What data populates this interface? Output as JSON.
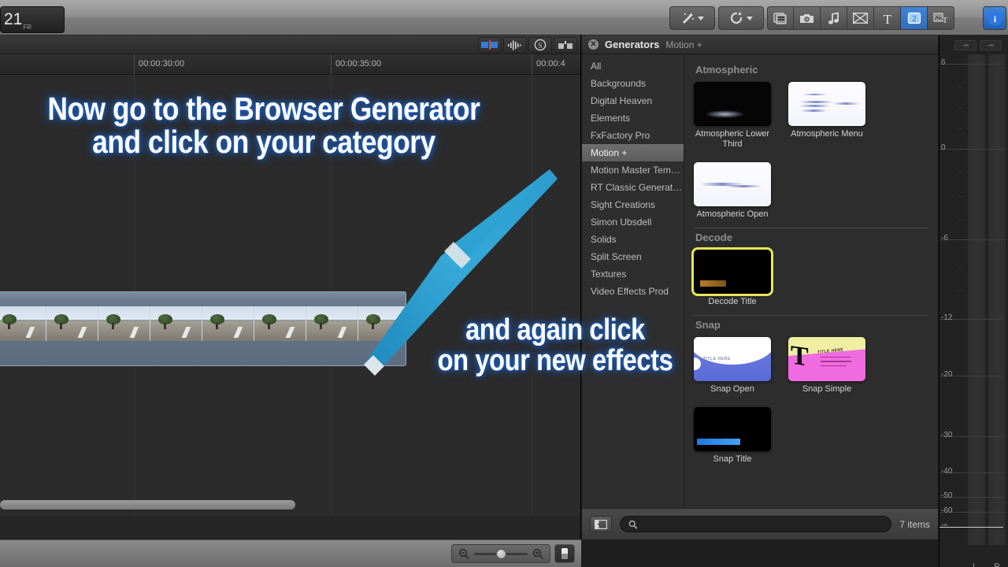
{
  "app": {
    "timecode": "21",
    "timecode_sub": "FR"
  },
  "toolbar": {
    "buttons": [
      {
        "name": "retime-tools",
        "icon": "magic-wand-icon",
        "label": "Enhancements",
        "has_caret": true,
        "active": false
      },
      {
        "name": "speed-tools",
        "icon": "retime-icon",
        "label": "Retime",
        "has_caret": true,
        "active": false
      },
      {
        "name": "media-browser",
        "icon": "media-browser-icon",
        "label": "Media Browser",
        "has_caret": false,
        "active": false
      },
      {
        "name": "photos-browser",
        "icon": "camera-icon",
        "label": "Photos",
        "has_caret": false,
        "active": false
      },
      {
        "name": "music-browser",
        "icon": "music-note-icon",
        "label": "Music and Sound",
        "has_caret": false,
        "active": false
      },
      {
        "name": "titles-browser",
        "icon": "titles-icon",
        "label": "Titles",
        "has_caret": false,
        "active": false
      },
      {
        "name": "text-tool",
        "icon": "text-T-icon",
        "label": "Text",
        "has_caret": false,
        "active": false
      },
      {
        "name": "generators-browser",
        "icon": "generators-icon",
        "label": "Generators",
        "has_caret": false,
        "active": true
      },
      {
        "name": "effects-browser",
        "icon": "effects-text-icon",
        "label": "Effects",
        "has_caret": false,
        "active": false
      }
    ],
    "info_button": {
      "name": "info-button",
      "icon": "info-circle-icon",
      "label": "Inspector"
    }
  },
  "timeline": {
    "tools": [
      "clip-skimming-icon",
      "audio-skimming-icon",
      "solo-icon",
      "snapping-icon"
    ],
    "ruler_ticks": [
      "00:00:30:00",
      "00:00:35:00",
      "00:00:4"
    ],
    "zoom": {
      "zoom_out_icon": "magnifier-minus-icon",
      "zoom_in_icon": "magnifier-plus-icon",
      "appearance_icon": "clip-appearance-icon",
      "value": 40
    },
    "clip": {
      "name": "timeline-filmstrip-clip",
      "frame_count": 9
    }
  },
  "browser": {
    "title": "Generators",
    "subtitle": "Motion +",
    "close_icon": "close-x-icon",
    "categories": [
      {
        "label": "All",
        "selected": false
      },
      {
        "label": "Backgrounds",
        "selected": false
      },
      {
        "label": "Digital Heaven",
        "selected": false
      },
      {
        "label": "Elements",
        "selected": false
      },
      {
        "label": "FxFactory Pro",
        "selected": false
      },
      {
        "label": "Motion +",
        "selected": true
      },
      {
        "label": "Motion Master Tem…",
        "selected": false
      },
      {
        "label": "RT Classic Generat…",
        "selected": false
      },
      {
        "label": "Sight Creations",
        "selected": false
      },
      {
        "label": "Simon Ubsdell",
        "selected": false
      },
      {
        "label": "Solids",
        "selected": false
      },
      {
        "label": "Split Screen",
        "selected": false
      },
      {
        "label": "Textures",
        "selected": false
      },
      {
        "label": "Video Effects Prod",
        "selected": false
      }
    ],
    "groups": [
      {
        "title": "Atmospheric",
        "items": [
          {
            "label": "Atmospheric Lower Third",
            "style": "atmos-dark",
            "selected": false
          },
          {
            "label": "Atmospheric Menu",
            "style": "atmos-light",
            "selected": false
          },
          {
            "label": "Atmospheric Open",
            "style": "atmos-light",
            "selected": false
          }
        ]
      },
      {
        "title": "Decode",
        "items": [
          {
            "label": "Decode Title",
            "style": "decode",
            "selected": true
          }
        ]
      },
      {
        "title": "Snap",
        "items": [
          {
            "label": "Snap Open",
            "style": "snap-open",
            "selected": false,
            "inner_text": "TITLE HERE"
          },
          {
            "label": "Snap Simple",
            "style": "snap-simple",
            "selected": false,
            "inner_text": "TITLE HERE"
          },
          {
            "label": "Snap Title",
            "style": "snap-title",
            "selected": false
          }
        ]
      }
    ],
    "footer": {
      "sidebar_toggle_icon": "sidebar-toggle-icon",
      "search_icon": "search-icon",
      "search_value": "",
      "search_placeholder": "",
      "item_count": "7 items"
    }
  },
  "meters": {
    "peak_left": "-∞",
    "peak_right": "-∞",
    "scale": [
      "6",
      "0",
      "-6",
      "-12",
      "-20",
      "-30",
      "-40",
      "-50",
      "-60",
      "-∞"
    ],
    "channel_left": "L",
    "channel_right": "R"
  },
  "overlays": {
    "top_line1": "Now go to the Browser Generator",
    "top_line2": "and click on your category",
    "bottom_line1": "and again click",
    "bottom_line2": "on your new  effects",
    "arrow_color": "#2e9fd0"
  }
}
